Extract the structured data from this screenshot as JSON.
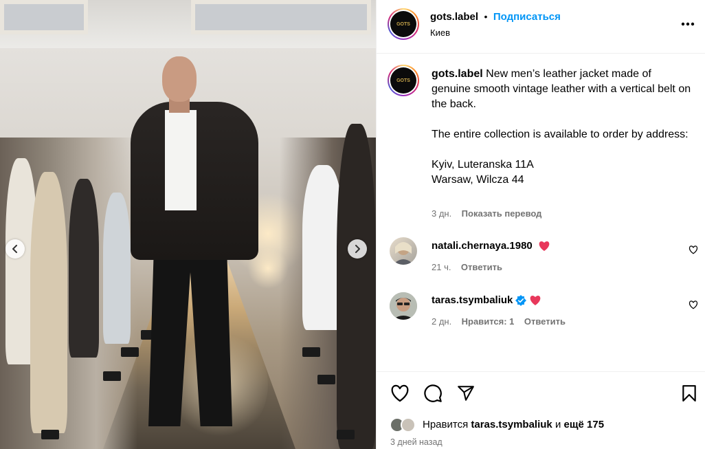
{
  "post": {
    "username": "gots.label",
    "follow_label": "Подписаться",
    "separator": "•",
    "location": "Киев",
    "avatar_logo_text": "GOTS",
    "more_icon": "more-horizontal-icon"
  },
  "caption": {
    "username": "gots.label",
    "text": "New men’s leather jacket made of genuine smooth vintage leather with a vertical belt on the back.\n\nThe entire collection is available to order by address:\n\nKyiv, Luteranska 11A\nWarsaw, Wilcza 44",
    "time": "3 дн.",
    "translate_label": "Показать перевод"
  },
  "comments": [
    {
      "username": "natali.chernaya.1980",
      "emoji": "heart-emoji",
      "time": "21 ч.",
      "reply_label": "Ответить",
      "likes_label": "",
      "verified": false
    },
    {
      "username": "taras.tsymbaliuk",
      "emoji": "heart-emoji",
      "time": "2 дн.",
      "likes_label": "Нравится: 1",
      "reply_label": "Ответить",
      "verified": true
    }
  ],
  "likes": {
    "prefix": "Нравится",
    "user": "taras.tsymbaliuk",
    "and": "и",
    "more": "ещё 175"
  },
  "posted_ago": "3 дней назад",
  "colors": {
    "accent_blue": "#0095f6",
    "muted": "#737373",
    "heart": "#e8385b",
    "verified": "#0095f6"
  },
  "icons": {
    "like": "heart-outline-icon",
    "comment": "comment-bubble-icon",
    "share": "paper-plane-icon",
    "save": "bookmark-icon",
    "prev": "chevron-left-icon",
    "next": "chevron-right-icon",
    "comment_like": "small-heart-icon"
  }
}
